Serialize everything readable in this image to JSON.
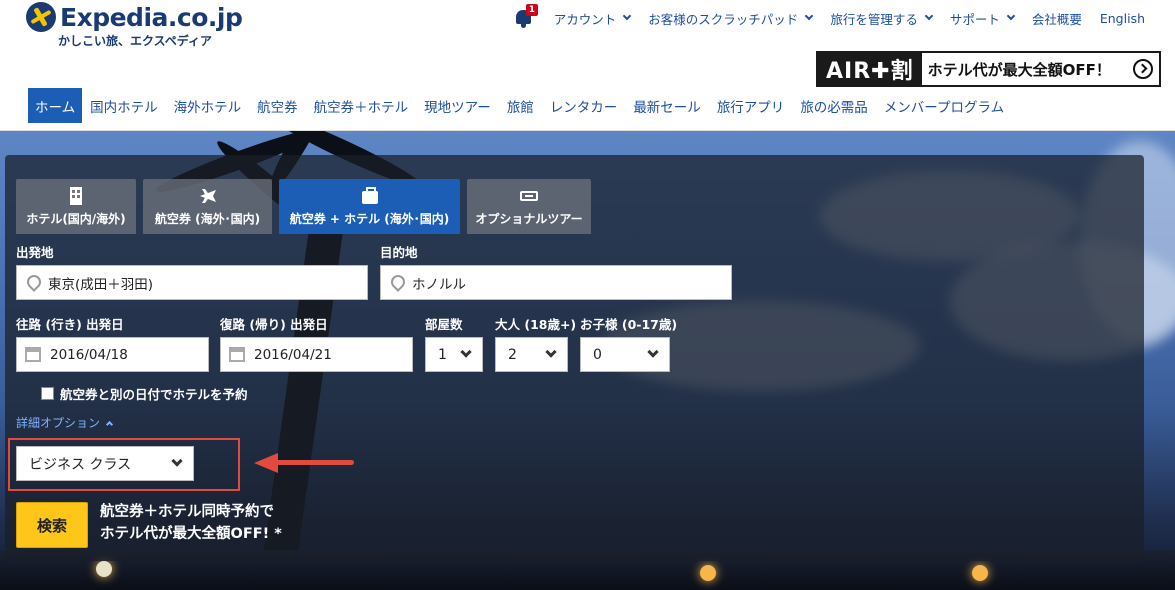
{
  "header": {
    "logo_text": "Expedia.co.jp",
    "logo_tagline": "かしこい旅、エクスペディア",
    "notification_count": "1",
    "top_links": [
      {
        "label": "アカウント",
        "dropdown": true
      },
      {
        "label": "お客様のスクラッチパッド",
        "dropdown": true
      },
      {
        "label": "旅行を管理する",
        "dropdown": true
      },
      {
        "label": "サポート",
        "dropdown": true
      },
      {
        "label": "会社概要",
        "dropdown": false
      },
      {
        "label": "English",
        "dropdown": false
      }
    ],
    "banner": {
      "badge": "AIR✚割",
      "text": "ホテル代が最大全額OFF！"
    }
  },
  "main_nav": {
    "items": [
      "ホーム",
      "国内ホテル",
      "海外ホテル",
      "航空券",
      "航空券＋ホテル",
      "現地ツアー",
      "旅館",
      "レンタカー",
      "最新セール",
      "旅行アプリ",
      "旅の必需品",
      "メンバープログラム"
    ],
    "active_index": 0
  },
  "search": {
    "tabs": [
      {
        "label": "ホテル(国内/海外)",
        "icon": "hotel-icon"
      },
      {
        "label": "航空券 (海外･国内)",
        "icon": "plane-icon"
      },
      {
        "label": "航空券 + ホテル (海外･国内)",
        "icon": "suitcase-icon"
      },
      {
        "label": "オプショナルツアー",
        "icon": "ticket-icon"
      }
    ],
    "active_tab": 2,
    "origin": {
      "label": "出発地",
      "value": "東京(成田＋羽田)"
    },
    "destination": {
      "label": "目的地",
      "value": "ホノルル"
    },
    "depart": {
      "label": "往路 (行き) 出発日",
      "value": "2016/04/18"
    },
    "return": {
      "label": "復路 (帰り) 出発日",
      "value": "2016/04/21"
    },
    "rooms": {
      "label": "部屋数",
      "value": "1"
    },
    "adults": {
      "label": "大人 (18歳+)",
      "value": "2"
    },
    "children": {
      "label": "お子様 (0-17歳)",
      "value": "0"
    },
    "separate_dates_checkbox": {
      "label": "航空券と別の日付でホテルを予約",
      "checked": false
    },
    "advanced_options_link": "詳細オプション",
    "cabin_class": {
      "value": "ビジネス クラス"
    },
    "search_button": "検索",
    "promo_line1": "航空券＋ホテル同時予約で",
    "promo_line2": "ホテル代が最大全額OFF! *"
  },
  "colors": {
    "brand_navy": "#1a3a73",
    "link_blue": "#1c4fa0",
    "active_blue": "#1c5eb5",
    "search_yellow": "#ffc61a",
    "annotation_red": "#e04a3f"
  }
}
